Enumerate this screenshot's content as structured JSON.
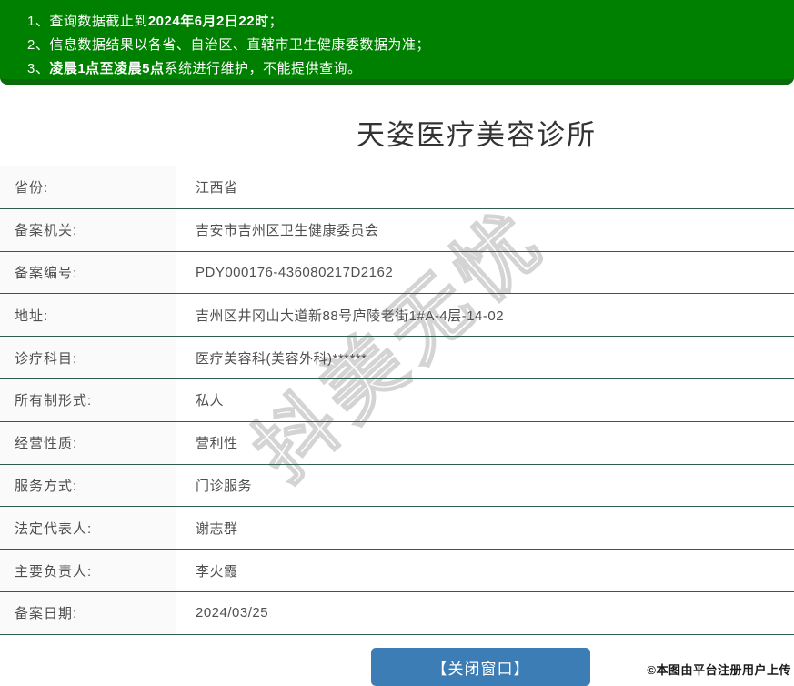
{
  "banner": {
    "lines": [
      {
        "pre": "1、查询数据截止到",
        "bold": "2024年6月2日22时",
        "post": "；"
      },
      {
        "pre": "2、信息数据结果以各省、自治区、直辖市卫生健康委数据为准；",
        "bold": "",
        "post": ""
      },
      {
        "pre": "3、",
        "bold": "凌晨1点至凌晨5点",
        "post": "系统进行维护，不能提供查询。"
      }
    ]
  },
  "clinic": {
    "title": "天姿医疗美容诊所"
  },
  "table": {
    "rows": [
      {
        "label": "省份:",
        "value": "江西省"
      },
      {
        "label": "备案机关:",
        "value": "吉安市吉州区卫生健康委员会"
      },
      {
        "label": "备案编号:",
        "value": "PDY000176-436080217D2162"
      },
      {
        "label": "地址:",
        "value": "吉州区井冈山大道新88号庐陵老街1#A-4层-14-02"
      },
      {
        "label": "诊疗科目:",
        "value": "医疗美容科(美容外科)******"
      },
      {
        "label": "所有制形式:",
        "value": "私人"
      },
      {
        "label": "经营性质:",
        "value": "营利性"
      },
      {
        "label": "服务方式:",
        "value": "门诊服务"
      },
      {
        "label": "法定代表人:",
        "value": "谢志群"
      },
      {
        "label": "主要负责人:",
        "value": "李火霞"
      },
      {
        "label": "备案日期:",
        "value": "2024/03/25"
      }
    ]
  },
  "watermark": {
    "text": "抖美无忧"
  },
  "footer": {
    "close_button": "【关闭窗口】",
    "credit": "©本图由平台注册用户上传"
  },
  "colors": {
    "banner_green": "#008000",
    "banner_border_green": "#0a6b0a",
    "row_separator": "#2e5e51",
    "label_background": "#fafafa",
    "button_blue": "#3c7db6",
    "text_gray": "#4f4f4f"
  }
}
